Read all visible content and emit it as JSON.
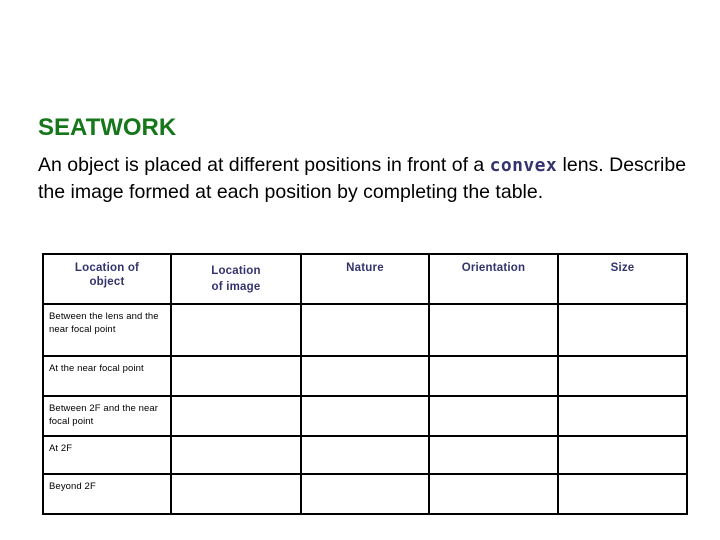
{
  "slide": {
    "title": "SEATWORK",
    "title_color": "#15761a",
    "body": {
      "part1": "An object is placed at different positions in front of a ",
      "keyword": "convex",
      "keyword_color": "#33336e",
      "part2": " lens. Describe the image formed at each position by completing the table."
    }
  },
  "table": {
    "header_color": "#33336e",
    "border_color": "#000000",
    "columns": [
      {
        "label_line1": "Location of",
        "label_line2": "object"
      },
      {
        "label_line1": "Location",
        "label_line2": "of image"
      },
      {
        "label_line1": "Nature",
        "label_line2": ""
      },
      {
        "label_line1": "Orientation",
        "label_line2": ""
      },
      {
        "label_line1": "Size",
        "label_line2": ""
      }
    ],
    "rows": [
      {
        "location_of_object": "Between the lens and the near focal point",
        "location_of_image": "",
        "nature": "",
        "orientation": "",
        "size": ""
      },
      {
        "location_of_object": "At the near focal point",
        "location_of_image": "",
        "nature": "",
        "orientation": "",
        "size": ""
      },
      {
        "location_of_object": "Between 2F and the near focal point",
        "location_of_image": "",
        "nature": "",
        "orientation": "",
        "size": ""
      },
      {
        "location_of_object": "At 2F",
        "location_of_image": "",
        "nature": "",
        "orientation": "",
        "size": ""
      },
      {
        "location_of_object": "Beyond 2F",
        "location_of_image": "",
        "nature": "",
        "orientation": "",
        "size": ""
      }
    ]
  }
}
